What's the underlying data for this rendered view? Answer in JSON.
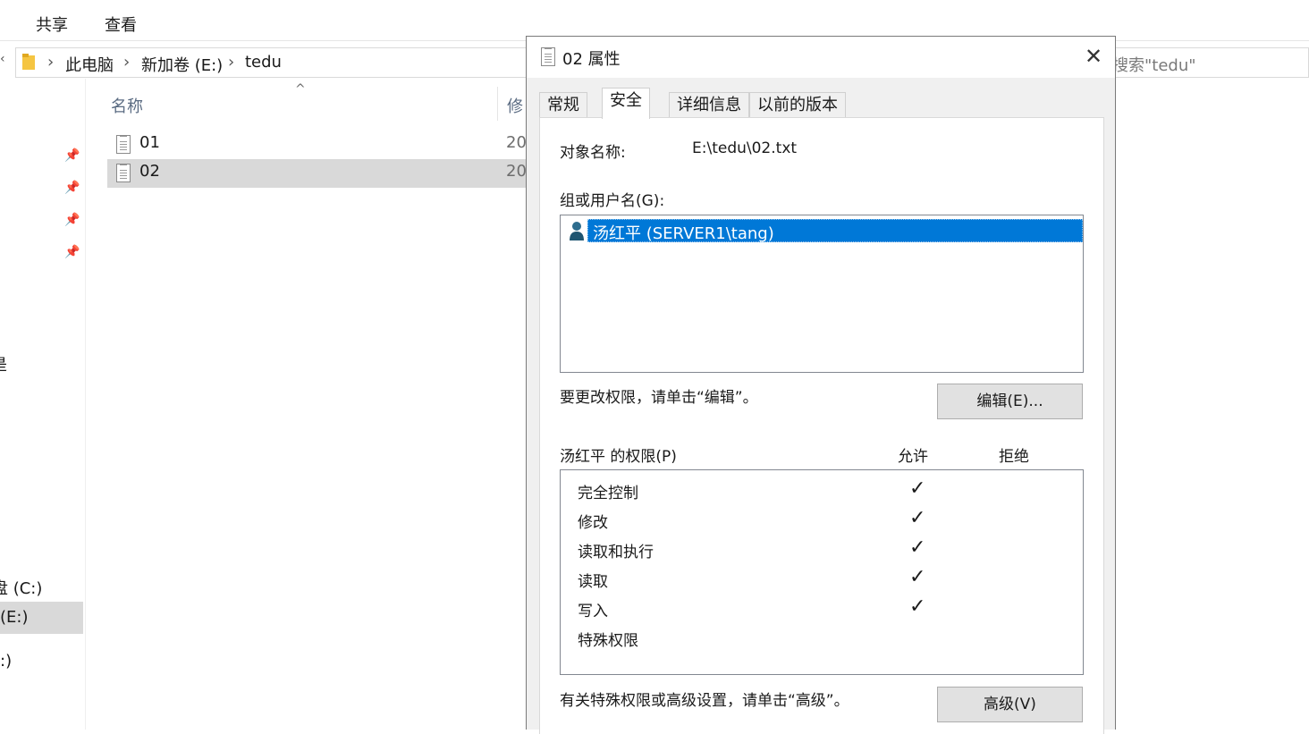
{
  "ribbon": {
    "tabs": [
      "共享",
      "查看"
    ]
  },
  "address_bar": {
    "crumbs": [
      "此电脑",
      "新加卷 (E:)",
      "tedu"
    ],
    "search_placeholder": "搜索\"tedu\""
  },
  "nav_pane": {
    "drive_c": "盘 (C:)",
    "drive_e": "(E:)",
    "drive_other": ":)",
    "partial": "是"
  },
  "file_list": {
    "col_name": "名称",
    "col_modified": "修",
    "files": [
      {
        "name": "01",
        "date": "20",
        "selected": false
      },
      {
        "name": "02",
        "date": "20",
        "selected": true
      }
    ]
  },
  "dialog": {
    "title": "02 属性",
    "tabs": [
      {
        "label": "常规",
        "active": false
      },
      {
        "label": "安全",
        "active": true
      },
      {
        "label": "详细信息",
        "active": false
      },
      {
        "label": "以前的版本",
        "active": false
      }
    ],
    "object_label": "对象名称:",
    "object_value": "E:\\tedu\\02.txt",
    "group_label": "组或用户名(G):",
    "users": [
      {
        "name": "汤红平 (SERVER1\\tang)",
        "selected": true
      }
    ],
    "edit_hint": "要更改权限，请单击“编辑”。",
    "edit_button": "编辑(E)...",
    "perm_header": "汤红平 的权限(P)",
    "allow_header": "允许",
    "deny_header": "拒绝",
    "permissions": [
      {
        "name": "完全控制",
        "allow": true,
        "deny": false
      },
      {
        "name": "修改",
        "allow": true,
        "deny": false
      },
      {
        "name": "读取和执行",
        "allow": true,
        "deny": false
      },
      {
        "name": "读取",
        "allow": true,
        "deny": false
      },
      {
        "name": "写入",
        "allow": true,
        "deny": false
      },
      {
        "name": "特殊权限",
        "allow": false,
        "deny": false
      }
    ],
    "advanced_hint": "有关特殊权限或高级设置，请单击“高级”。",
    "advanced_button": "高级(V)",
    "check_glyph": "✓"
  }
}
